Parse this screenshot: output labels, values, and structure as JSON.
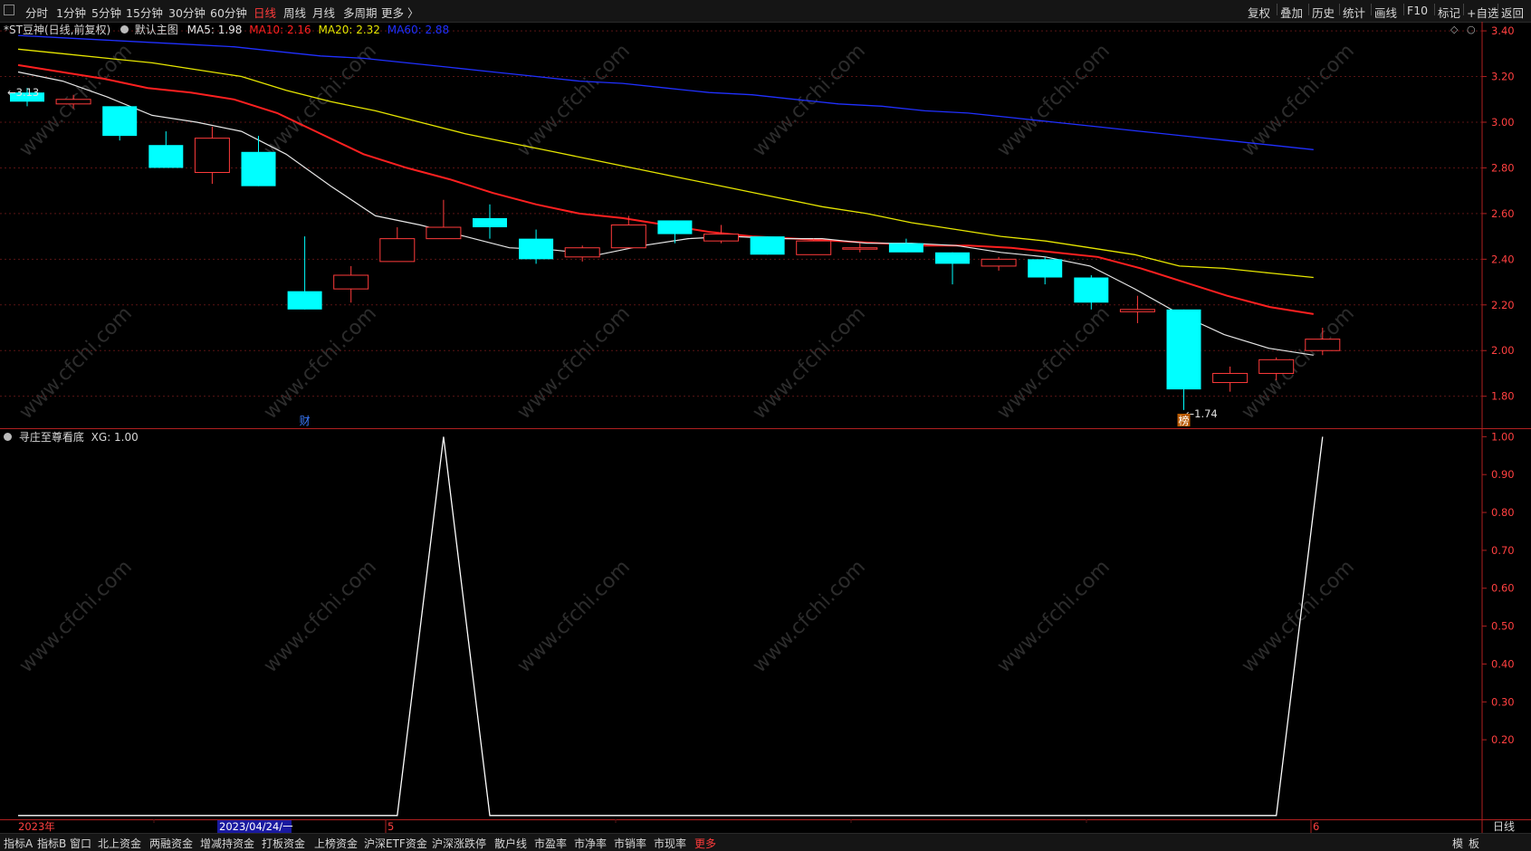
{
  "toolbar": {
    "periods": [
      "分时",
      "1分钟",
      "5分钟",
      "15分钟",
      "30分钟",
      "60分钟",
      "日线",
      "周线",
      "月线",
      "多周期",
      "更多 〉"
    ],
    "active_period": "日线",
    "right_buttons": [
      "复权",
      "叠加",
      "历史",
      "统计",
      "画线",
      "F10",
      "标记",
      "+自选",
      "返回"
    ]
  },
  "chart_header": {
    "stock": "*ST豆神(日线,前复权)",
    "main_label": "默认主图",
    "ma5": "MA5: 1.98",
    "ma10": "MA10: 2.16",
    "ma20": "MA20: 2.32",
    "ma60": "MA60: 2.88"
  },
  "indicator_header": {
    "name": "寻庄至尊看底",
    "xg": "XG: 1.00"
  },
  "annotations": {
    "high_label": "3.13",
    "low_label": "1.74",
    "fin_marker": "财",
    "bang_marker": "榜"
  },
  "x_axis": {
    "start": "2023年",
    "cursor_date": "2023/04/24/一",
    "month5": "5",
    "month6": "6"
  },
  "period_label": "日线",
  "bottom_tabs": [
    "指标A",
    "指标B",
    "窗口",
    "北上资金",
    "两融资金",
    "增减持资金",
    "打板资金",
    "上榜资金",
    "沪深ETF资金",
    "沪深涨跌停",
    "散户线",
    "市盈率",
    "市净率",
    "市销率",
    "市现率",
    "更多"
  ],
  "bottom_right": [
    "模",
    "板"
  ],
  "watermark": "www.cfchi.com",
  "colors": {
    "up": "#ff3b3b",
    "down": "#00ffff",
    "ma5": "#e6e6e6",
    "ma10": "#ff2020",
    "ma20": "#e6e600",
    "ma60": "#2030ff",
    "indicator": "#ffffff"
  },
  "chart_data": [
    {
      "type": "candlestick",
      "title": "*ST豆神(日线,前复权)",
      "y_ticks": [
        3.4,
        3.2,
        3.0,
        2.8,
        2.6,
        2.4,
        2.2,
        2.0,
        1.8
      ],
      "ylim": [
        1.66,
        3.44
      ],
      "candles": [
        {
          "o": 3.13,
          "c": 3.09,
          "h": 3.15,
          "l": 3.07
        },
        {
          "o": 3.08,
          "c": 3.1,
          "h": 3.12,
          "l": 3.06
        },
        {
          "o": 3.07,
          "c": 2.94,
          "h": 3.07,
          "l": 2.92
        },
        {
          "o": 2.9,
          "c": 2.8,
          "h": 2.96,
          "l": 2.8
        },
        {
          "o": 2.78,
          "c": 2.93,
          "h": 2.98,
          "l": 2.73
        },
        {
          "o": 2.87,
          "c": 2.72,
          "h": 2.94,
          "l": 2.72
        },
        {
          "o": 2.26,
          "c": 2.18,
          "h": 2.5,
          "l": 2.18
        },
        {
          "o": 2.27,
          "c": 2.33,
          "h": 2.37,
          "l": 2.21
        },
        {
          "o": 2.39,
          "c": 2.49,
          "h": 2.54,
          "l": 2.39
        },
        {
          "o": 2.49,
          "c": 2.54,
          "h": 2.66,
          "l": 2.49
        },
        {
          "o": 2.58,
          "c": 2.54,
          "h": 2.64,
          "l": 2.49
        },
        {
          "o": 2.49,
          "c": 2.4,
          "h": 2.53,
          "l": 2.38
        },
        {
          "o": 2.41,
          "c": 2.45,
          "h": 2.46,
          "l": 2.39
        },
        {
          "o": 2.45,
          "c": 2.55,
          "h": 2.59,
          "l": 2.45
        },
        {
          "o": 2.57,
          "c": 2.51,
          "h": 2.57,
          "l": 2.47
        },
        {
          "o": 2.48,
          "c": 2.51,
          "h": 2.55,
          "l": 2.47
        },
        {
          "o": 2.5,
          "c": 2.42,
          "h": 2.5,
          "l": 2.42
        },
        {
          "o": 2.42,
          "c": 2.48,
          "h": 2.49,
          "l": 2.42
        },
        {
          "o": 2.45,
          "c": 2.45,
          "h": 2.47,
          "l": 2.43
        },
        {
          "o": 2.47,
          "c": 2.43,
          "h": 2.49,
          "l": 2.43
        },
        {
          "o": 2.43,
          "c": 2.38,
          "h": 2.43,
          "l": 2.29
        },
        {
          "o": 2.37,
          "c": 2.4,
          "h": 2.41,
          "l": 2.35
        },
        {
          "o": 2.4,
          "c": 2.32,
          "h": 2.41,
          "l": 2.29
        },
        {
          "o": 2.32,
          "c": 2.21,
          "h": 2.33,
          "l": 2.18
        },
        {
          "o": 2.17,
          "c": 2.18,
          "h": 2.24,
          "l": 2.12
        },
        {
          "o": 2.18,
          "c": 1.83,
          "h": 2.18,
          "l": 1.74
        },
        {
          "o": 1.86,
          "c": 1.9,
          "h": 1.93,
          "l": 1.82
        },
        {
          "o": 1.9,
          "c": 1.96,
          "h": 1.97,
          "l": 1.87
        },
        {
          "o": 2.0,
          "c": 2.05,
          "h": 2.1,
          "l": 1.98
        }
      ],
      "ma5": [
        3.22,
        3.18,
        3.11,
        3.03,
        3.0,
        2.96,
        2.86,
        2.72,
        2.59,
        2.55,
        2.5,
        2.45,
        2.44,
        2.42,
        2.46,
        2.49,
        2.5,
        2.49,
        2.49,
        2.47,
        2.47,
        2.46,
        2.43,
        2.41,
        2.37,
        2.27,
        2.16,
        2.07,
        2.01,
        1.98
      ],
      "ma10": [
        3.25,
        3.22,
        3.19,
        3.15,
        3.13,
        3.1,
        3.04,
        2.95,
        2.86,
        2.8,
        2.75,
        2.69,
        2.64,
        2.6,
        2.58,
        2.55,
        2.52,
        2.5,
        2.49,
        2.48,
        2.47,
        2.46,
        2.46,
        2.45,
        2.43,
        2.41,
        2.36,
        2.3,
        2.24,
        2.19,
        2.16
      ],
      "ma20": [
        3.32,
        3.3,
        3.28,
        3.26,
        3.23,
        3.2,
        3.14,
        3.09,
        3.05,
        3.0,
        2.95,
        2.91,
        2.87,
        2.83,
        2.79,
        2.75,
        2.71,
        2.67,
        2.63,
        2.6,
        2.56,
        2.53,
        2.5,
        2.48,
        2.45,
        2.42,
        2.37,
        2.36,
        2.34,
        2.32
      ],
      "ma60": [
        3.38,
        3.37,
        3.36,
        3.35,
        3.34,
        3.33,
        3.31,
        3.29,
        3.28,
        3.26,
        3.24,
        3.22,
        3.2,
        3.18,
        3.17,
        3.15,
        3.13,
        3.12,
        3.1,
        3.08,
        3.07,
        3.05,
        3.04,
        3.02,
        3.0,
        2.98,
        2.96,
        2.94,
        2.92,
        2.9,
        2.88
      ]
    },
    {
      "type": "line",
      "title": "寻庄至尊看底",
      "y_ticks": [
        1.0,
        0.9,
        0.8,
        0.7,
        0.6,
        0.5,
        0.4,
        0.3,
        0.2
      ],
      "ylim": [
        -0.01,
        1.02
      ],
      "series": [
        {
          "name": "XG",
          "values": [
            0,
            0,
            0,
            0,
            0,
            0,
            0,
            0,
            0,
            1,
            0,
            0,
            0,
            0,
            0,
            0,
            0,
            0,
            0,
            0,
            0,
            0,
            0,
            0,
            0,
            0,
            0,
            0,
            1
          ]
        }
      ]
    }
  ]
}
